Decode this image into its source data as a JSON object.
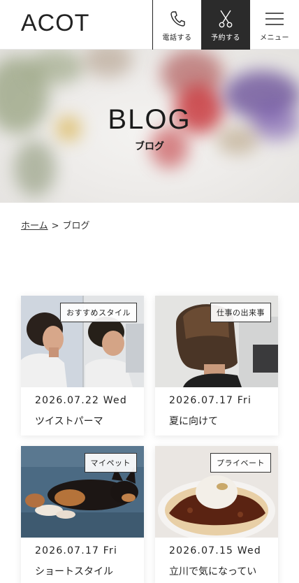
{
  "header": {
    "logo": "ACOT",
    "tel_label": "電話する",
    "reserve_label": "予約する",
    "menu_label": "メニュー"
  },
  "hero": {
    "title": "BLOG",
    "subtitle": "ブログ"
  },
  "breadcrumb": {
    "home": "ホーム",
    "separator": ">",
    "current": "ブログ"
  },
  "posts": [
    {
      "tag": "おすすめスタイル",
      "date": "2026.07.22 Wed",
      "title": "ツイストパーマ"
    },
    {
      "tag": "仕事の出来事",
      "date": "2026.07.17 Fri",
      "title": "夏に向けて"
    },
    {
      "tag": "マイペット",
      "date": "2026.07.17 Fri",
      "title": "ショートスタイル"
    },
    {
      "tag": "プライベート",
      "date": "2026.07.15 Wed",
      "title": "立川で気になってい"
    }
  ]
}
